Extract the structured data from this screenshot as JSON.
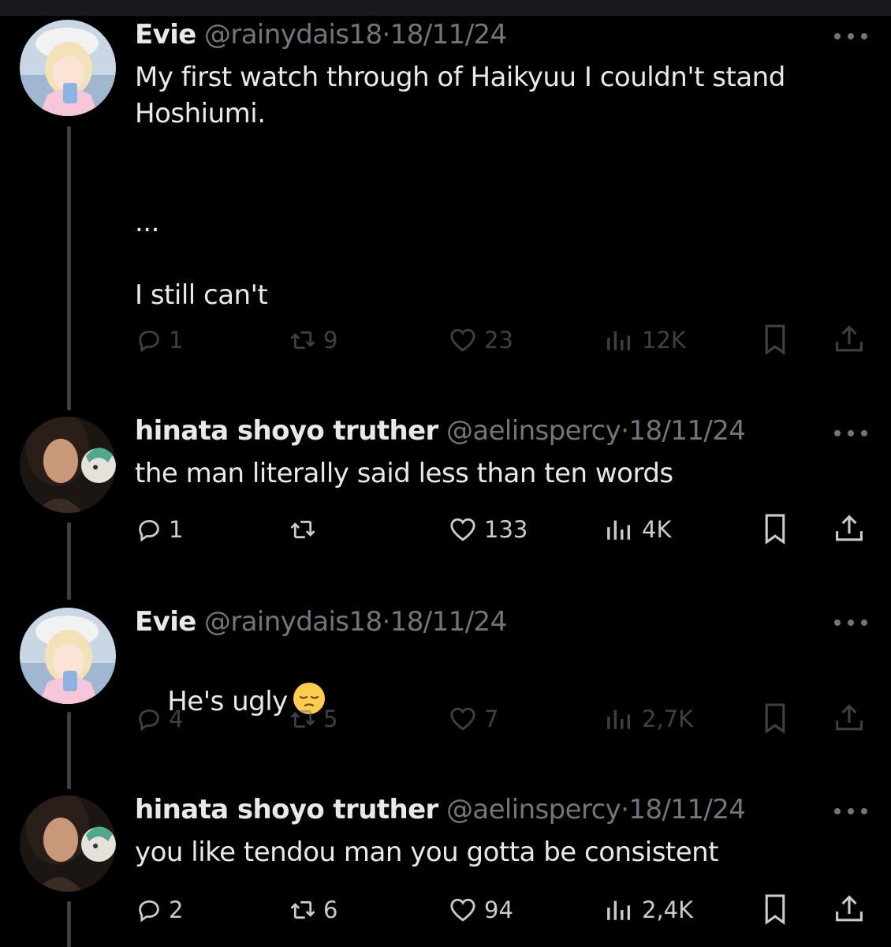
{
  "tweets": [
    {
      "name": "Evie",
      "handle": "@rainydais18",
      "separator": "·",
      "date": "18/11/24",
      "text": "My first watch through of Haikyuu I couldn't stand Hoshiumi.\n\n\n...\n\nI still can't",
      "replies": "1",
      "reposts": "9",
      "likes": "23",
      "views": "12K",
      "avatar_icon": "anime-girl-avatar"
    },
    {
      "name": "hinata shoyo truther",
      "handle": "@aelinspercy",
      "separator": "·",
      "date": "18/11/24",
      "text": "the man literally said less than ten words",
      "replies": "1",
      "reposts": "",
      "likes": "133",
      "views": "4K",
      "avatar_icon": "selfie-avatar"
    },
    {
      "name": "Evie",
      "handle": "@rainydais18",
      "separator": "·",
      "date": "18/11/24",
      "text": "He's ugly",
      "emoji": "pensive-face-emoji",
      "replies": "4",
      "reposts": "5",
      "likes": "7",
      "views": "2,7K",
      "avatar_icon": "anime-girl-avatar"
    },
    {
      "name": "hinata shoyo truther",
      "handle": "@aelinspercy",
      "separator": "·",
      "date": "18/11/24",
      "text": "you like tendou man you gotta be consistent",
      "replies": "2",
      "reposts": "6",
      "likes": "94",
      "views": "2,4K",
      "avatar_icon": "selfie-avatar"
    }
  ],
  "colors": {
    "background": "#000000",
    "primary_text": "#e7e9ea",
    "secondary_text": "#71767b",
    "thread_line": "#3e4144"
  }
}
